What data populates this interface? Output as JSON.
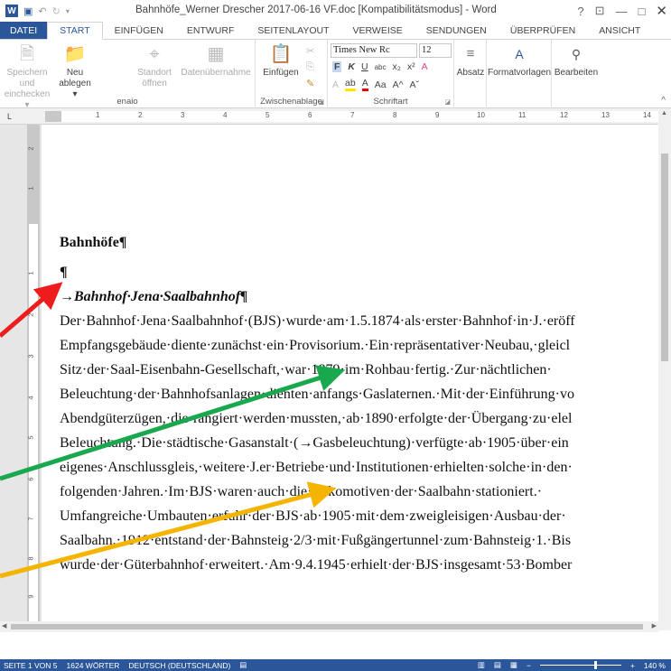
{
  "title_bar": {
    "document_title": "Bahnhöfe_Werner Drescher 2017-06-16 VF.doc [Kompatibilitätsmodus] - Word",
    "help": "?",
    "ribbon_display": "⊡",
    "minimize": "—",
    "restore": "□",
    "close": "✕"
  },
  "tabs": [
    "DATEI",
    "START",
    "EINFÜGEN",
    "ENTWURF",
    "SEITENLAYOUT",
    "VERWEISE",
    "SENDUNGEN",
    "ÜBERPRÜFEN",
    "ANSICHT"
  ],
  "ribbon": {
    "save_checkin": [
      "Speichern und",
      "einchecken ▾"
    ],
    "new_file": [
      "Neu",
      "ablegen ▾"
    ],
    "site": [
      "Standort",
      "öffnen"
    ],
    "data_transfer": "Datenübernahme",
    "group_enaio": "enaio",
    "paste": "Einfügen",
    "group_clipboard": "Zwischenablage",
    "font_name": "Times New Rc",
    "font_size": "12",
    "group_font": "Schriftart",
    "paragraph": "Absatz",
    "styles": "Formatvorlagen",
    "editing": "Bearbeiten"
  },
  "ruler_numbers": [
    "1",
    "2",
    "3",
    "4",
    "5",
    "6",
    "7",
    "8",
    "9",
    "10",
    "11",
    "12",
    "13",
    "14"
  ],
  "vruler_numbers": [
    "2",
    "1",
    "1",
    "2",
    "3",
    "4",
    "5",
    "6",
    "7",
    "8",
    "9",
    "10"
  ],
  "document": {
    "heading1": "Bahnhöfe¶",
    "empty_para": "¶",
    "heading2": "→Bahnhof·Jena·Saalbahnhof¶",
    "lines": [
      "Der·Bahnhof·Jena·Saalbahnhof·(BJS)·wurde·am·1.5.1874·als·erster·Bahnhof·in·J.·eröff",
      "Empfangsgebäude·diente·zunächst·ein·Provisorium.·Ein·repräsentativer·Neubau,·gleicl",
      "Sitz·der·Saal-Eisenbahn-Gesellschaft,·war·1879·im·Rohbau·fertig.·Zur·nächtlichen·",
      "Beleuchtung·der·Bahnhofsanlagen·dienten·anfangs·Gaslaternen.·Mit·der·Einführung·vo",
      "Abendgüterzügen,·die·rangiert·werden·mussten,·ab·1890·erfolgte·der·Übergang·zu·elel",
      "Beleuchtung.·Die·städtische·Gasanstalt·(→Gasbeleuchtung)·verfügte·ab·1905·über·ein",
      "eigenes·Anschlussgleis,·weitere·J.er·Betriebe·und·Institutionen·erhielten·solche·in·den·",
      "folgenden·Jahren.·Im·BJS·waren·auch·die·Lokomotiven·der·Saalbahn·stationiert.·",
      "Umfangreiche·Umbauten·erfuhr·der·BJS·ab·1905·mit·dem·zweigleisigen·Ausbau·der·",
      "Saalbahn.·1912·entstand·der·Bahnsteig·2/3·mit·Fußgängertunnel·zum·Bahnsteig·1.·Bis",
      "wurde·der·Güterbahnhof·erweitert.·Am·9.4.1945·erhielt·der·BJS·insgesamt·53·Bomber"
    ]
  },
  "status_bar": {
    "page": "SEITE 1 VON 5",
    "words": "1624 WÖRTER",
    "language": "DEUTSCH (DEUTSCHLAND)",
    "zoom": "140 %",
    "zoom_minus": "−",
    "zoom_plus": "+"
  },
  "colors": {
    "word_blue": "#2b579a",
    "arrow_red": "#ee1c1c",
    "arrow_green": "#1aa84f",
    "arrow_orange": "#f5b400"
  }
}
